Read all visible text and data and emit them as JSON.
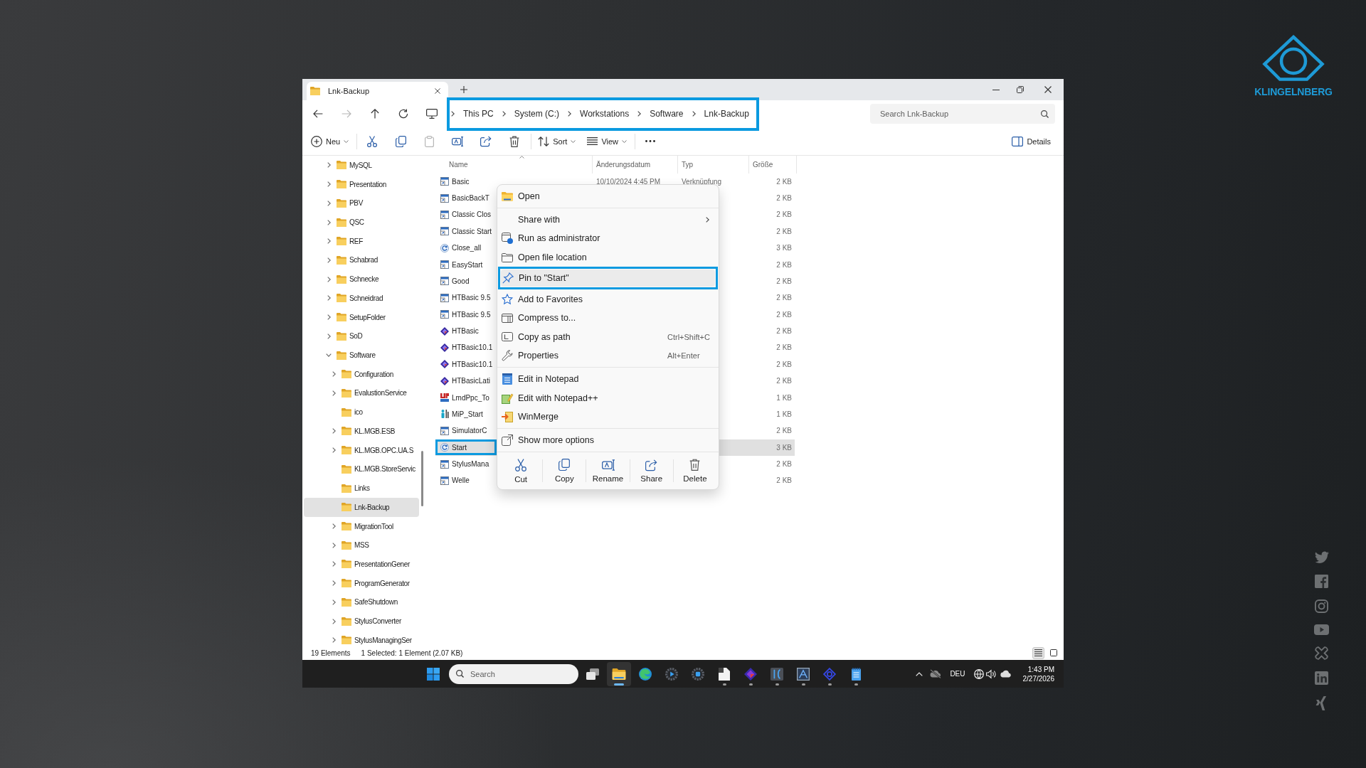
{
  "brand": {
    "name": "KLINGELNBERG"
  },
  "explorer": {
    "tabs": [
      {
        "label": "Lnk-Backup",
        "selected": true
      }
    ],
    "nav_buttons": [
      {
        "disabled": false
      },
      {
        "disabled": true
      },
      {
        "disabled": false
      },
      {
        "disabled": false
      }
    ],
    "breadcrumb": {
      "highlighted": true,
      "items": [
        "This PC",
        "System (C:)",
        "Workstations",
        "Software",
        "Lnk-Backup"
      ]
    },
    "search": {
      "placeholder": "Search Lnk-Backup"
    },
    "toolbar": {
      "groups": [
        [
          {
            "label": "Neu",
            "disabled": false
          }
        ],
        [
          {
            "disabled": false
          },
          {
            "disabled": false
          },
          {
            "disabled": true
          },
          {
            "disabled": false
          },
          {
            "disabled": false
          },
          {
            "disabled": false
          }
        ],
        [
          {
            "label": "Sort",
            "disabled": false
          },
          {
            "label": "View",
            "disabled": false
          }
        ],
        [
          {
            "disabled": false
          }
        ]
      ],
      "details": {
        "label": "Details"
      }
    },
    "sidebar": {
      "items": [
        {
          "label": "MySQL",
          "expandable": true,
          "expanded": false,
          "selected": false
        },
        {
          "label": "Presentation",
          "expandable": true,
          "expanded": false,
          "selected": false
        },
        {
          "label": "PBV",
          "expandable": true,
          "expanded": false,
          "selected": false
        },
        {
          "label": "QSC",
          "expandable": true,
          "expanded": false,
          "selected": false
        },
        {
          "label": "REF",
          "expandable": true,
          "expanded": false,
          "selected": false
        },
        {
          "label": "Schabrad",
          "expandable": true,
          "expanded": false,
          "selected": false
        },
        {
          "label": "Schnecke",
          "expandable": true,
          "expanded": false,
          "selected": false
        },
        {
          "label": "Schneidrad",
          "expandable": true,
          "expanded": false,
          "selected": false
        },
        {
          "label": "SetupFolder",
          "expandable": true,
          "expanded": false,
          "selected": false
        },
        {
          "label": "SoD",
          "expandable": true,
          "expanded": false,
          "selected": false
        },
        {
          "label": "Software",
          "expandable": true,
          "expanded": true,
          "selected": false,
          "children": [
            {
              "label": "Configuration",
              "expandable": true,
              "expanded": false,
              "selected": false
            },
            {
              "label": "EvalustionService",
              "expandable": true,
              "expanded": false,
              "selected": false
            },
            {
              "label": "ico",
              "expandable": false,
              "expanded": false,
              "selected": false
            },
            {
              "label": "KL.MGB.ESB",
              "expandable": true,
              "expanded": false,
              "selected": false
            },
            {
              "label": "KL.MGB.OPC.UA.S",
              "expandable": true,
              "expanded": false,
              "selected": false
            },
            {
              "label": "KL.MGB.StoreServic",
              "expandable": false,
              "expanded": false,
              "selected": false
            },
            {
              "label": "Links",
              "expandable": false,
              "expanded": false,
              "selected": false
            },
            {
              "label": "Lnk-Backup",
              "expandable": false,
              "expanded": false,
              "selected": true
            },
            {
              "label": "MigrationTool",
              "expandable": true,
              "expanded": false,
              "selected": false
            },
            {
              "label": "MSS",
              "expandable": true,
              "expanded": false,
              "selected": false
            },
            {
              "label": "PresentationGener",
              "expandable": true,
              "expanded": false,
              "selected": false
            },
            {
              "label": "ProgramGenerator",
              "expandable": true,
              "expanded": false,
              "selected": false
            },
            {
              "label": "SafeShutdown",
              "expandable": true,
              "expanded": false,
              "selected": false
            },
            {
              "label": "StylusConverter",
              "expandable": true,
              "expanded": false,
              "selected": false
            },
            {
              "label": "StylusManagingSer",
              "expandable": true,
              "expanded": false,
              "selected": false
            }
          ]
        }
      ]
    },
    "table": {
      "columns": [
        {
          "label": "Name",
          "sorted": true
        },
        {
          "label": "Änderungsdatum",
          "sorted": false
        },
        {
          "label": "Typ",
          "sorted": false
        },
        {
          "label": "Größe",
          "sorted": false
        }
      ],
      "rows": [
        {
          "name": "Basic",
          "kind": "window",
          "date": "10/10/2024 4:45 PM",
          "type": "Verknüpfung",
          "size": "2 KB",
          "selected": false,
          "highlighted": false
        },
        {
          "name": "BasicBackT",
          "kind": "window",
          "size": "2 KB",
          "selected": false,
          "highlighted": false
        },
        {
          "name": "Classic Clos",
          "kind": "window",
          "size": "2 KB",
          "selected": false,
          "highlighted": false
        },
        {
          "name": "Classic Start",
          "kind": "window",
          "size": "2 KB",
          "selected": false,
          "highlighted": false
        },
        {
          "name": "Close_all",
          "kind": "cycle",
          "size": "3 KB",
          "selected": false,
          "highlighted": false
        },
        {
          "name": "EasyStart",
          "kind": "window",
          "size": "2 KB",
          "selected": false,
          "highlighted": false
        },
        {
          "name": "Good",
          "kind": "window",
          "size": "2 KB",
          "selected": false,
          "highlighted": false
        },
        {
          "name": "HTBasic 9.5",
          "kind": "window",
          "size": "2 KB",
          "selected": false,
          "highlighted": false
        },
        {
          "name": "HTBasic 9.5",
          "kind": "window",
          "size": "2 KB",
          "selected": false,
          "highlighted": false
        },
        {
          "name": "HTBasic",
          "kind": "diamond",
          "size": "2 KB",
          "selected": false,
          "highlighted": false
        },
        {
          "name": "HTBasic10.1",
          "kind": "diamond",
          "size": "2 KB",
          "selected": false,
          "highlighted": false
        },
        {
          "name": "HTBasic10.1",
          "kind": "diamond",
          "size": "2 KB",
          "selected": false,
          "highlighted": false
        },
        {
          "name": "HTBasicLati",
          "kind": "diamond",
          "size": "2 KB",
          "selected": false,
          "highlighted": false
        },
        {
          "name": "LmdPpc_To",
          "kind": "badge",
          "size": "1 KB",
          "selected": false,
          "highlighted": false
        },
        {
          "name": "MiP_Start",
          "kind": "figure",
          "size": "1 KB",
          "selected": false,
          "highlighted": false
        },
        {
          "name": "SimulatorC",
          "kind": "window",
          "size": "2 KB",
          "selected": false,
          "highlighted": false
        },
        {
          "name": "Start",
          "kind": "cycle",
          "size": "3 KB",
          "selected": true,
          "highlighted": true
        },
        {
          "name": "StylusMana",
          "kind": "window",
          "size": "2 KB",
          "selected": false,
          "highlighted": false
        },
        {
          "name": "Welle",
          "kind": "window",
          "size": "2 KB",
          "selected": false,
          "highlighted": false
        }
      ]
    },
    "status_bar": {
      "count": "19 Elements",
      "selection": "1 Selected: 1 Element (2.07 KB)",
      "views": [
        {
          "selected": true
        },
        {
          "selected": false
        }
      ]
    }
  },
  "context_menu": {
    "groups": [
      [
        {
          "label": "Open",
          "submenu": false,
          "highlighted": false
        }
      ],
      [
        {
          "label": "Share with",
          "submenu": true,
          "highlighted": false
        },
        {
          "label": "Run as administrator",
          "submenu": false,
          "highlighted": false
        },
        {
          "label": "Open file location",
          "submenu": false,
          "highlighted": false
        },
        {
          "label": "Pin to \"Start\"",
          "submenu": false,
          "highlighted": true
        },
        {
          "label": "Add to Favorites",
          "submenu": false,
          "highlighted": false
        },
        {
          "label": "Compress to...",
          "submenu": false,
          "highlighted": false
        },
        {
          "label": "Copy as path",
          "shortcut": "Ctrl+Shift+C",
          "submenu": false,
          "highlighted": false
        },
        {
          "label": "Properties",
          "shortcut": "Alt+Enter",
          "submenu": false,
          "highlighted": false
        }
      ],
      [
        {
          "label": "Edit in Notepad",
          "submenu": false,
          "highlighted": false
        },
        {
          "label": "Edit with Notepad++",
          "submenu": false,
          "highlighted": false
        },
        {
          "label": "WinMerge",
          "submenu": false,
          "highlighted": false
        }
      ],
      [
        {
          "label": "Show more options",
          "submenu": false,
          "highlighted": false
        }
      ]
    ],
    "actions": [
      {
        "label": "Cut"
      },
      {
        "label": "Copy"
      },
      {
        "label": "Rename"
      },
      {
        "label": "Share"
      },
      {
        "label": "Delete"
      }
    ]
  },
  "taskbar": {
    "search": {
      "placeholder": "Search"
    },
    "apps": [
      {
        "running": false,
        "selected": false
      },
      {
        "running": true,
        "selected": true
      },
      {
        "running": false,
        "selected": false
      },
      {
        "running": false,
        "selected": false
      },
      {
        "running": false,
        "selected": false
      },
      {
        "running": true,
        "selected": false
      },
      {
        "running": true,
        "selected": false
      },
      {
        "running": true,
        "selected": false
      },
      {
        "running": true,
        "selected": false
      },
      {
        "running": true,
        "selected": false
      },
      {
        "running": true,
        "selected": false
      }
    ],
    "tray": {
      "language": "DEU",
      "time": "1:43 PM",
      "date": "2/27/2026"
    }
  }
}
